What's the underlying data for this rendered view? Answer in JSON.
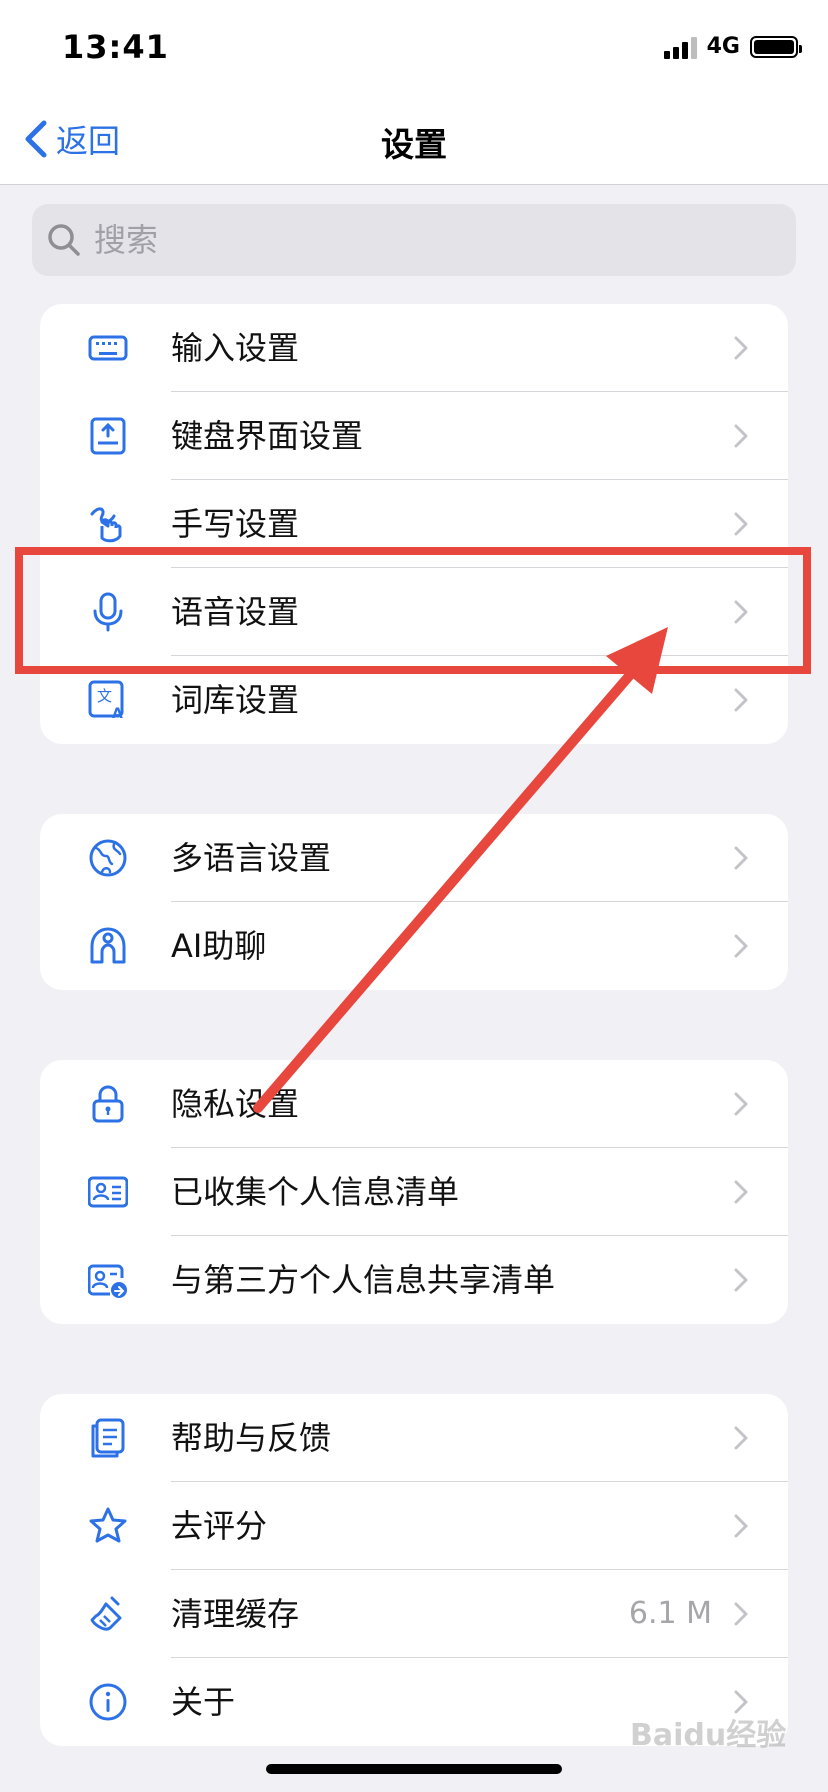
{
  "status_bar": {
    "time": "13:41",
    "network": "4G"
  },
  "nav": {
    "back_label": "返回",
    "title": "设置"
  },
  "search": {
    "placeholder": "搜索"
  },
  "groups": [
    {
      "items": [
        {
          "label": "输入设置",
          "icon": "keyboard-icon"
        },
        {
          "label": "键盘界面设置",
          "icon": "keyboard-layout-icon"
        },
        {
          "label": "手写设置",
          "icon": "handwriting-icon"
        },
        {
          "label": "语音设置",
          "icon": "microphone-icon"
        },
        {
          "label": "词库设置",
          "icon": "dictionary-icon"
        }
      ]
    },
    {
      "items": [
        {
          "label": "多语言设置",
          "icon": "globe-icon"
        },
        {
          "label": "AI助聊",
          "icon": "ai-assistant-icon"
        }
      ]
    },
    {
      "items": [
        {
          "label": "隐私设置",
          "icon": "lock-icon"
        },
        {
          "label": "已收集个人信息清单",
          "icon": "id-card-icon"
        },
        {
          "label": "与第三方个人信息共享清单",
          "icon": "id-card-share-icon"
        }
      ]
    },
    {
      "items": [
        {
          "label": "帮助与反馈",
          "icon": "help-doc-icon"
        },
        {
          "label": "去评分",
          "icon": "star-icon"
        },
        {
          "label": "清理缓存",
          "icon": "broom-icon",
          "value": "6.1 M"
        },
        {
          "label": "关于",
          "icon": "info-icon"
        }
      ]
    }
  ],
  "annotation": {
    "highlighted_item": "语音设置",
    "color": "#E8473D"
  },
  "accent_color": "#2C72E6",
  "watermark": "Baidu经验"
}
